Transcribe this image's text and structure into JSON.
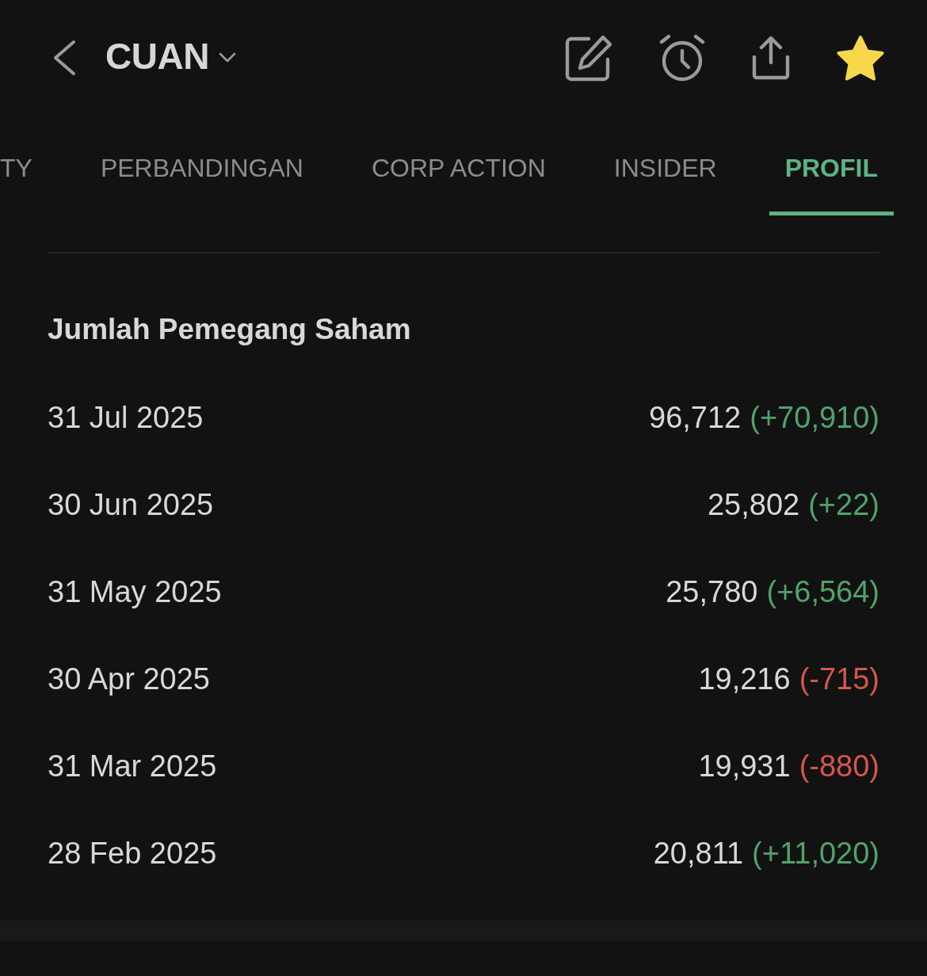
{
  "header": {
    "title": "CUAN",
    "favorite": true
  },
  "tabs": [
    {
      "label": "TY",
      "selected": false
    },
    {
      "label": "PERBANDINGAN",
      "selected": false
    },
    {
      "label": "CORP ACTION",
      "selected": false
    },
    {
      "label": "INSIDER",
      "selected": false
    },
    {
      "label": "PROFIL",
      "selected": true
    }
  ],
  "section": {
    "title": "Jumlah Pemegang Saham",
    "rows": [
      {
        "date": "31 Jul 2025",
        "value": "96,712",
        "change": "(+70,910)",
        "negative": false
      },
      {
        "date": "30 Jun 2025",
        "value": "25,802",
        "change": "(+22)",
        "negative": false
      },
      {
        "date": "31 May 2025",
        "value": "25,780",
        "change": "(+6,564)",
        "negative": false
      },
      {
        "date": "30 Apr 2025",
        "value": "19,216",
        "change": "(-715)",
        "negative": true
      },
      {
        "date": "31 Mar 2025",
        "value": "19,931",
        "change": "(-880)",
        "negative": true
      },
      {
        "date": "28 Feb 2025",
        "value": "20,811",
        "change": "(+11,020)",
        "negative": false
      }
    ]
  }
}
